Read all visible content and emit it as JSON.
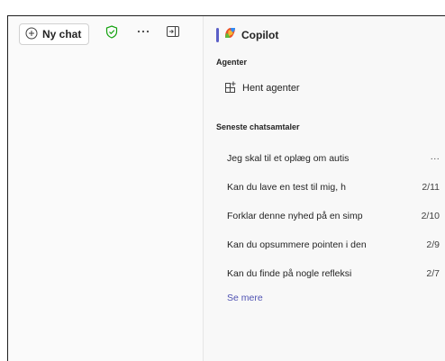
{
  "toolbar": {
    "new_chat_label": "Ny chat"
  },
  "copilot": {
    "title": "Copilot"
  },
  "agents": {
    "section_label": "Agenter",
    "get_agents_label": "Hent agenter"
  },
  "recent": {
    "section_label": "Seneste chatsamtaler",
    "items": [
      {
        "title": "Jeg skal til et oplæg om autis",
        "meta": "···"
      },
      {
        "title": "Kan du lave en test til mig, h",
        "meta": "2/11"
      },
      {
        "title": "Forklar denne nyhed på en simp",
        "meta": "2/10"
      },
      {
        "title": "Kan du opsummere pointen i den",
        "meta": "2/9"
      },
      {
        "title": "Kan du finde på nogle refleksi",
        "meta": "2/7"
      }
    ],
    "see_more_label": "Se mere"
  },
  "colors": {
    "accent": "#5b5fc7",
    "link": "#4f52b2",
    "shield": "#13a10e"
  },
  "icons": [
    "add-circle-icon",
    "shield-check-icon",
    "more-icon",
    "sidebar-collapse-icon",
    "copilot-logo-icon",
    "apps-add-icon"
  ]
}
